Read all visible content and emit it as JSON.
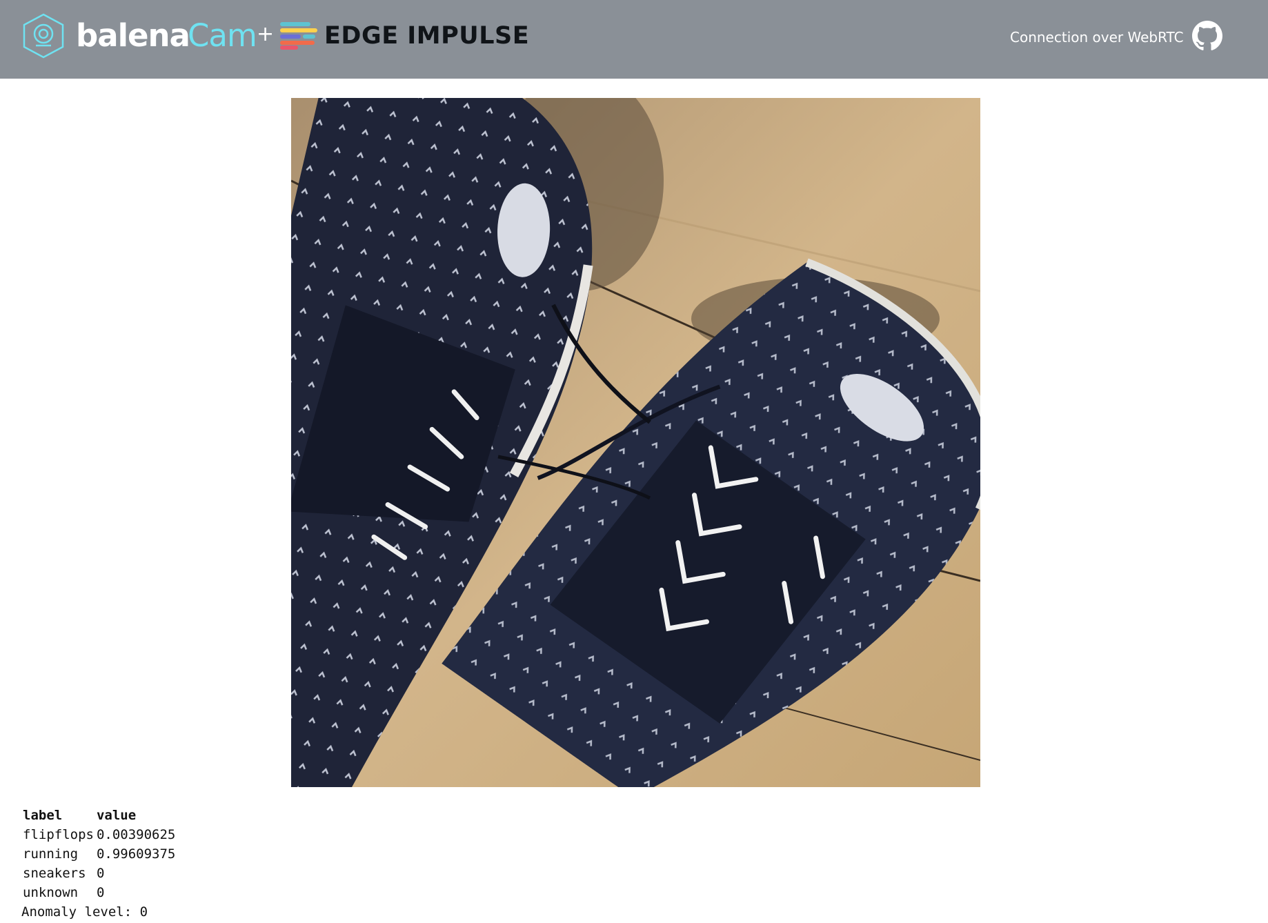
{
  "header": {
    "brand_balena": "balena",
    "brand_cam": "Cam",
    "brand_plus": "+",
    "brand_edge_impulse": "EDGE IMPULSE",
    "connection_text": "Connection over WebRTC",
    "icons": [
      "balenacam-hexagon-icon",
      "edge-impulse-logo-icon",
      "github-icon"
    ],
    "colors": {
      "bar": "#8a9097",
      "cam_accent": "#6fe2f1"
    }
  },
  "camera": {
    "subject": "Two dark navy running sneakers with white laces on a wooden floor"
  },
  "results": {
    "columns": [
      "label",
      "value"
    ],
    "rows": [
      {
        "label": "flipflops",
        "value": "0.00390625"
      },
      {
        "label": "running",
        "value": "0.99609375"
      },
      {
        "label": "sneakers",
        "value": "0"
      },
      {
        "label": "unknown",
        "value": "0"
      }
    ],
    "anomaly_text": "Anomaly level: 0"
  }
}
